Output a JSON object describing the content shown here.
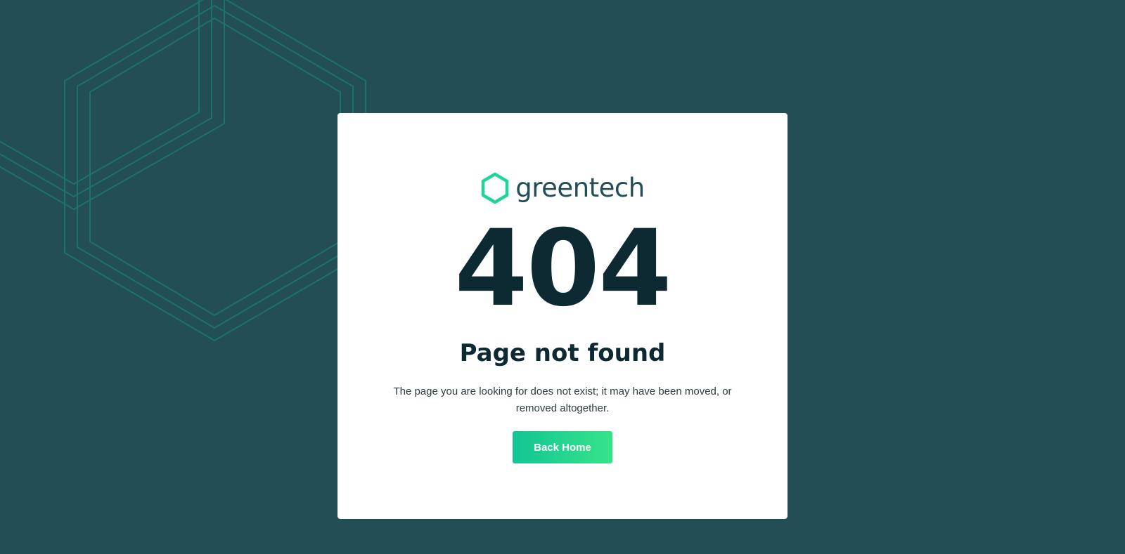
{
  "brand": {
    "name": "greentech",
    "logo_icon": "hexagon-icon",
    "accent_color": "#1fd597",
    "text_color": "#244e56"
  },
  "error": {
    "code": "404",
    "title": "Page not found",
    "message": "The page you are looking for does not exist; it may have been moved, or removed altogether."
  },
  "actions": {
    "back_home_label": "Back Home"
  },
  "colors": {
    "background": "#244e56",
    "card": "#ffffff",
    "heading": "#0d2a33",
    "button_gradient_start": "#12c594",
    "button_gradient_end": "#37e389",
    "decor_lines": "#1b7a6d"
  }
}
